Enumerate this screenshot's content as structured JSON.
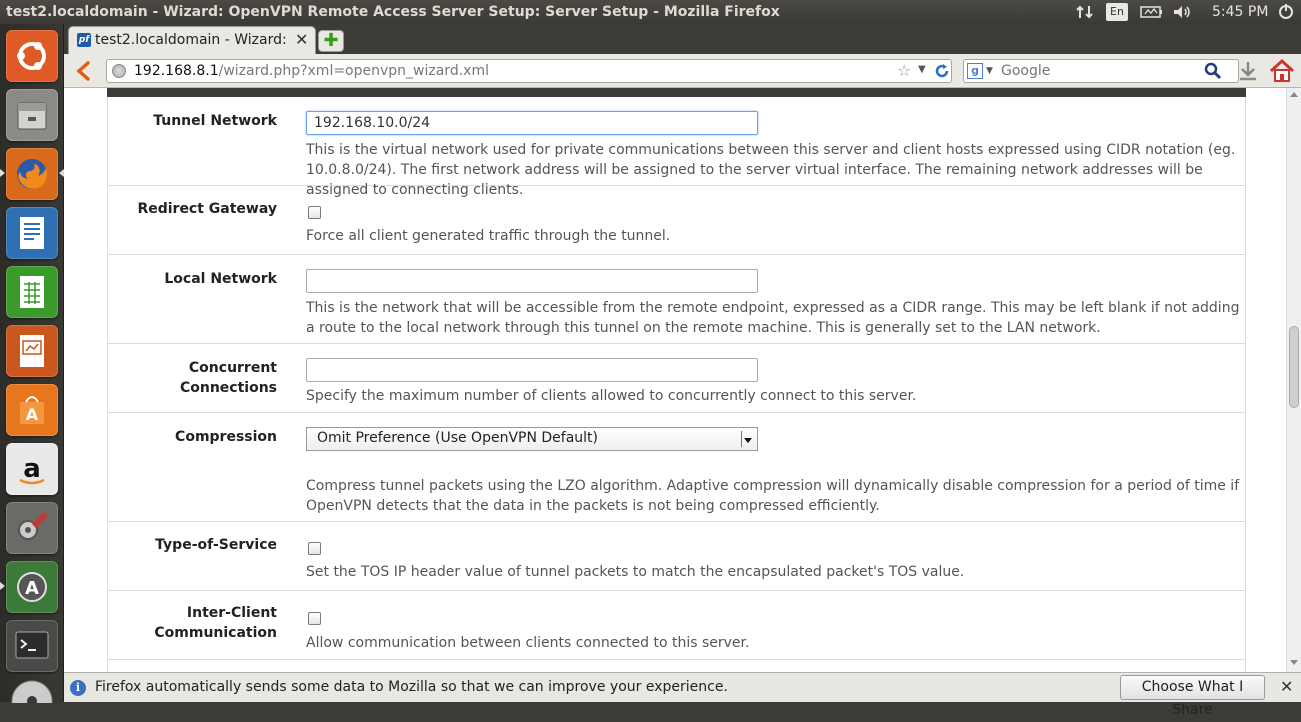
{
  "window": {
    "title": "test2.localdomain - Wizard: OpenVPN Remote Access Server Setup: Server Setup - Mozilla Firefox"
  },
  "tray": {
    "language": "En",
    "clock": "5:45 PM"
  },
  "launcher": {
    "items": [
      "ubuntu-dash",
      "files",
      "firefox",
      "libreoffice-writer",
      "libreoffice-calc",
      "libreoffice-impress",
      "ubuntu-software-center",
      "amazon",
      "system-settings",
      "software-updater",
      "terminal",
      "disc"
    ]
  },
  "browser": {
    "tab_label": "test2.localdomain - Wizard: O...",
    "tab_close": "✕",
    "new_tab": "✚",
    "url_host": "192.168.8.1",
    "url_path": "/wizard.php?xml=openvpn_wizard.xml",
    "search_placeholder": "Google",
    "search_engine_letter": "g"
  },
  "form": {
    "rows": [
      {
        "label": "Tunnel Network",
        "type": "text",
        "value": "192.168.10.0/24",
        "help": "This is the virtual network used for private communications between this server and client hosts expressed using CIDR notation (eg. 10.0.8.0/24). The first network address will be assigned to the server virtual interface. The remaining network addresses will be assigned to connecting clients."
      },
      {
        "label": "Redirect Gateway",
        "type": "checkbox",
        "checked": false,
        "help": "Force all client generated traffic through the tunnel."
      },
      {
        "label": "Local Network",
        "type": "text",
        "value": "",
        "help": "This is the network that will be accessible from the remote endpoint, expressed as a CIDR range. This may be left blank if not adding a route to the local network through this tunnel on the remote machine. This is generally set to the LAN network."
      },
      {
        "label": "Concurrent Connections",
        "type": "text",
        "value": "",
        "help": "Specify the maximum number of clients allowed to concurrently connect to this server."
      },
      {
        "label": "Compression",
        "type": "select",
        "value": "Omit Preference (Use OpenVPN Default)",
        "help": "Compress tunnel packets using the LZO algorithm. Adaptive compression will dynamically disable compression for a period of time if OpenVPN detects that the data in the packets is not being compressed efficiently."
      },
      {
        "label": "Type-of-Service",
        "type": "checkbox",
        "checked": false,
        "help": "Set the TOS IP header value of tunnel packets to match the encapsulated packet's TOS value."
      },
      {
        "label_line1": "Inter-Client",
        "label_line2": "Communication",
        "type": "checkbox",
        "checked": false,
        "help": "Allow communication between clients connected to this server."
      }
    ]
  },
  "notification": {
    "text": "Firefox automatically sends some data to Mozilla so that we can improve your experience.",
    "button": "Choose What I Share",
    "close": "✕",
    "icon_letter": "i"
  }
}
